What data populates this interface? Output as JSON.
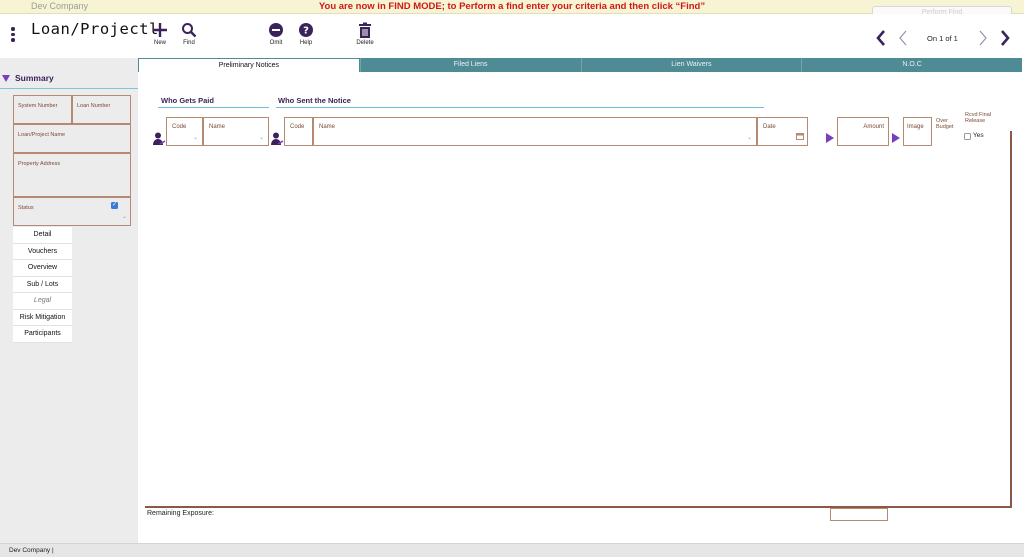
{
  "banner": {
    "company": "Dev Company",
    "find_mode_message": "You are now in FIND MODE; to Perform a find enter your criteria and then click “Find”",
    "find_button_label": "Perform Find"
  },
  "toolbar": {
    "title": "Loan/Projectl",
    "buttons": {
      "new": "New",
      "find": "Find",
      "omit": "Omit",
      "help": "Help",
      "delete": "Delete"
    },
    "record_position": "On 1 of 1"
  },
  "summary": {
    "header": "Summary",
    "fields": {
      "system_number": "System Number",
      "loan_number": "Loan Number",
      "loan_project_name": "Loan/Project Name",
      "property_address": "Property Address",
      "status": "Status"
    }
  },
  "nav": {
    "items": [
      "Detail",
      "Vouchers",
      "Overview",
      "Sub / Lots",
      "Legal",
      "Risk Mitigation",
      "Participants"
    ]
  },
  "tabs": [
    "Preliminary Notices",
    "Filed Liens",
    "Lien Waivers",
    "N.O.C"
  ],
  "notices": {
    "who_gets_paid": "Who Gets Paid",
    "who_sent": "Who Sent the Notice",
    "columns": {
      "code1": "Code",
      "name1": "Name",
      "code2": "Code",
      "name2": "Name",
      "date": "Date",
      "amount": "Amount",
      "image": "Image",
      "over_budget": "Over Budget",
      "rcvd_final_release": "Rcvd Final Release",
      "yes": "Yes"
    },
    "remaining_exposure": "Remaining Exposure:"
  },
  "status_bar": {
    "text": "Dev Company |"
  },
  "colors": {
    "accent_purple": "#3a235a",
    "tab_teal": "#4f8b95",
    "field_border": "#b58a72",
    "banner_red": "#d01818"
  }
}
